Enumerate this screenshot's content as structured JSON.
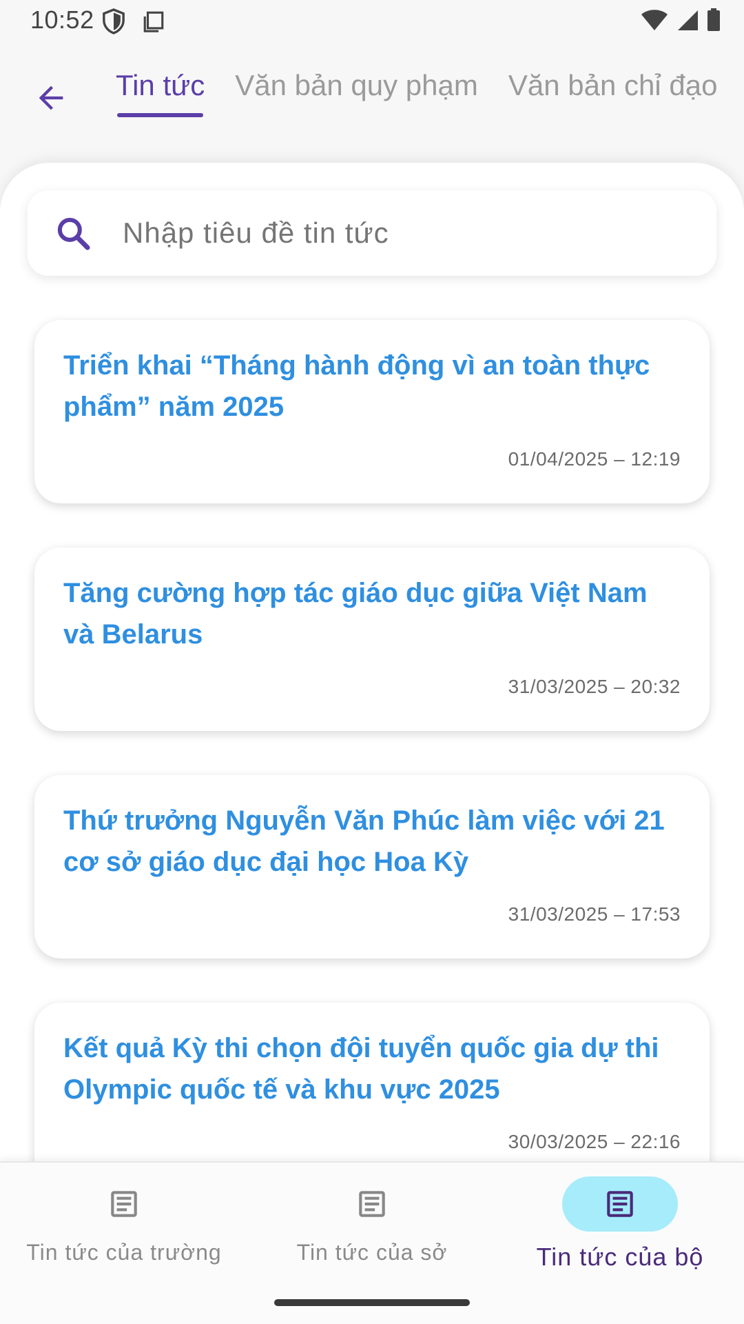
{
  "status_bar": {
    "time": "10:52"
  },
  "top_bar": {
    "tabs": [
      {
        "label": "Tin tức",
        "active": true
      },
      {
        "label": "Văn bản quy phạm",
        "active": false
      },
      {
        "label": "Văn bản chỉ đạo",
        "active": false
      }
    ]
  },
  "search": {
    "placeholder": "Nhập tiêu đề tin tức"
  },
  "news": [
    {
      "title": "Triển khai “Tháng hành động vì an toàn thực phẩm” năm 2025",
      "time": "01/04/2025 – 12:19"
    },
    {
      "title": "Tăng cường hợp tác giáo dục giữa Việt Nam và Belarus",
      "time": "31/03/2025 – 20:32"
    },
    {
      "title": "Thứ trưởng Nguyễn Văn Phúc làm việc với 21 cơ sở giáo dục đại học Hoa Kỳ",
      "time": "31/03/2025 – 17:53"
    },
    {
      "title": "Kết quả Kỳ thi chọn đội tuyển quốc gia dự thi Olympic quốc tế và khu vực 2025",
      "time": "30/03/2025 – 22:16"
    }
  ],
  "bottom_nav": {
    "items": [
      {
        "label": "Tin tức của trường",
        "icon": "document-icon",
        "active": false
      },
      {
        "label": "Tin tức của sở",
        "icon": "document-icon",
        "active": false
      },
      {
        "label": "Tin tức của bộ",
        "icon": "document-icon",
        "active": true
      }
    ]
  },
  "colors": {
    "accent": "#5b3ea8",
    "title_blue": "#2f8fe0",
    "active_pill": "#a7ecfb"
  }
}
